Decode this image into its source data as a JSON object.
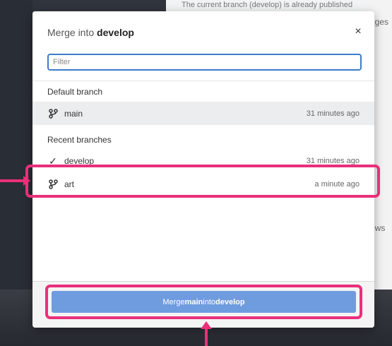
{
  "background": {
    "top_text": "The current branch (develop) is already published",
    "right_text_top": "nges",
    "right_text_bottom": "ows"
  },
  "dialog": {
    "title_prefix": "Merge into ",
    "title_branch": "develop",
    "close_icon": "close-icon",
    "filter": {
      "placeholder": "Filter",
      "value": ""
    },
    "sections": {
      "default_label": "Default branch",
      "recent_label": "Recent branches"
    },
    "branches": {
      "main": {
        "name": "main",
        "time": "31 minutes ago",
        "icon": "git-branch-icon",
        "selected": true
      },
      "develop": {
        "name": "develop",
        "time": "31 minutes ago",
        "icon": "check-icon",
        "current": true
      },
      "art": {
        "name": "art",
        "time": "a minute ago",
        "icon": "git-branch-icon",
        "highlighted": true
      }
    },
    "merge_button": {
      "prefix": "Merge ",
      "source": "main",
      "middle": " into ",
      "target": "develop"
    }
  },
  "annotations": {
    "highlight_color": "#ea2f7b",
    "arrow_left_icon": "arrow-right-icon",
    "arrow_up_icon": "arrow-up-icon"
  },
  "colors": {
    "accent_blue": "#3d7cc9",
    "merge_button_blue": "#6f9cdf",
    "selected_row": "#ecedef"
  }
}
